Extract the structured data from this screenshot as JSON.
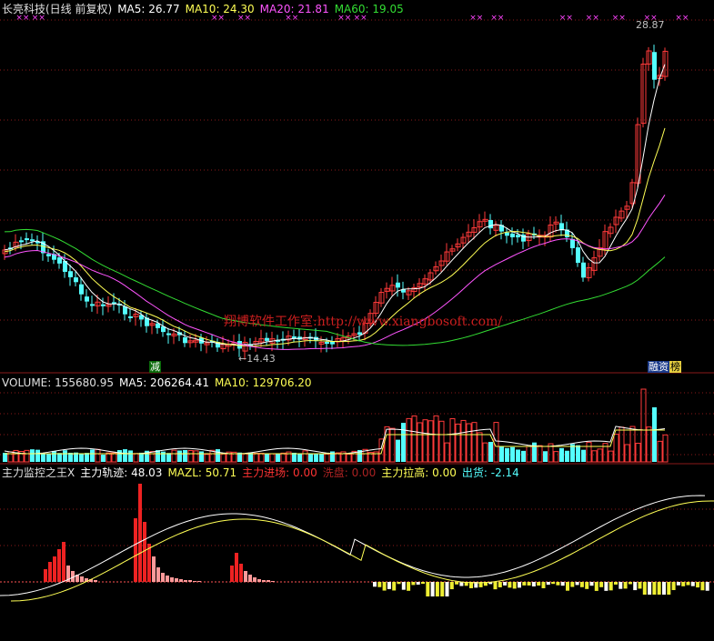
{
  "price": {
    "header": [
      {
        "t": "长亮科技(日线 前复权)",
        "c": "#e0e0e0"
      },
      {
        "t": "MA5: 26.77",
        "c": "#ffffff"
      },
      {
        "t": "MA10: 24.30",
        "c": "#ffff55"
      },
      {
        "t": "MA20: 21.81",
        "c": "#ff55ff"
      },
      {
        "t": "MA60: 19.05",
        "c": "#33dd33"
      }
    ],
    "high_label": "28.87",
    "low_label": "←14.43",
    "watermark": "翔博软件工作室:http://www.xiangbosoft.com/",
    "tag_jian": "减",
    "tag_rong": "融",
    "tag_bang": "榜",
    "colors": {
      "up": "#ff3a3a",
      "down": "#54ffff",
      "ma5": "#ffffff",
      "ma10": "#ffff55",
      "ma20": "#ff55ff",
      "ma60": "#33dd33"
    }
  },
  "volume": {
    "header": [
      {
        "t": "VOLUME: 155680.95",
        "c": "#e0e0e0"
      },
      {
        "t": "MA5: 206264.41",
        "c": "#ffffff"
      },
      {
        "t": "MA10: 129706.20",
        "c": "#ffff55"
      }
    ]
  },
  "indicator": {
    "header": [
      {
        "t": "主力监控之王X",
        "c": "#e0e0e0"
      },
      {
        "t": "主力轨迹: 48.03",
        "c": "#ffffff"
      },
      {
        "t": "MAZL: 50.71",
        "c": "#ffff55"
      },
      {
        "t": "主力进场: 0.00",
        "c": "#ff3333"
      },
      {
        "t": "洗盘: 0.00",
        "c": "#aa2222"
      },
      {
        "t": "主力拉高: 0.00",
        "c": "#ffff55"
      },
      {
        "t": "出货: -2.14",
        "c": "#54ffff"
      }
    ]
  }
}
